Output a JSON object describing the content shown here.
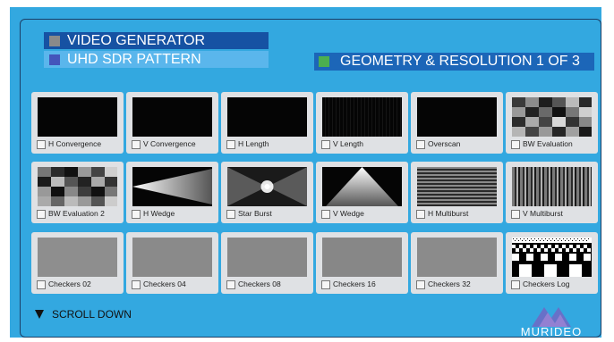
{
  "header": {
    "title": "VIDEO GENERATOR",
    "subtitle": "UHD SDR PATTERN",
    "page_label": "GEOMETRY & RESOLUTION 1 OF 3",
    "title_square_color": "#888888",
    "subtitle_square_color": "#4455bb",
    "page_square_color": "#4caf50"
  },
  "patterns": [
    {
      "label": "H Convergence",
      "icon": "h-convergence-pattern"
    },
    {
      "label": "V Convergence",
      "icon": "v-convergence-pattern"
    },
    {
      "label": "H Length",
      "icon": "h-length-pattern"
    },
    {
      "label": "V Length",
      "icon": "v-length-pattern"
    },
    {
      "label": "Overscan",
      "icon": "overscan-pattern"
    },
    {
      "label": "BW Evaluation",
      "icon": "bw-evaluation-pattern"
    },
    {
      "label": "BW Evaluation 2",
      "icon": "bw-evaluation-2-pattern"
    },
    {
      "label": "H Wedge",
      "icon": "h-wedge-pattern"
    },
    {
      "label": "Star Burst",
      "icon": "star-burst-pattern"
    },
    {
      "label": "V Wedge",
      "icon": "v-wedge-pattern"
    },
    {
      "label": "H Multiburst",
      "icon": "h-multiburst-pattern"
    },
    {
      "label": "V Multiburst",
      "icon": "v-multiburst-pattern"
    },
    {
      "label": "Checkers 02",
      "icon": "checkers-pattern"
    },
    {
      "label": "Checkers 04",
      "icon": "checkers-pattern"
    },
    {
      "label": "Checkers 08",
      "icon": "checkers-pattern"
    },
    {
      "label": "Checkers 16",
      "icon": "checkers-pattern"
    },
    {
      "label": "Checkers 32",
      "icon": "checkers-pattern"
    },
    {
      "label": "Checkers Log",
      "icon": "checkers-log-pattern"
    }
  ],
  "footer": {
    "scroll_label": "SCROLL DOWN",
    "logo_text": "MURIDEO"
  },
  "colors": {
    "background": "#33a8e0",
    "tile": "#dfe1e4",
    "accent_dark": "#1652a3"
  }
}
